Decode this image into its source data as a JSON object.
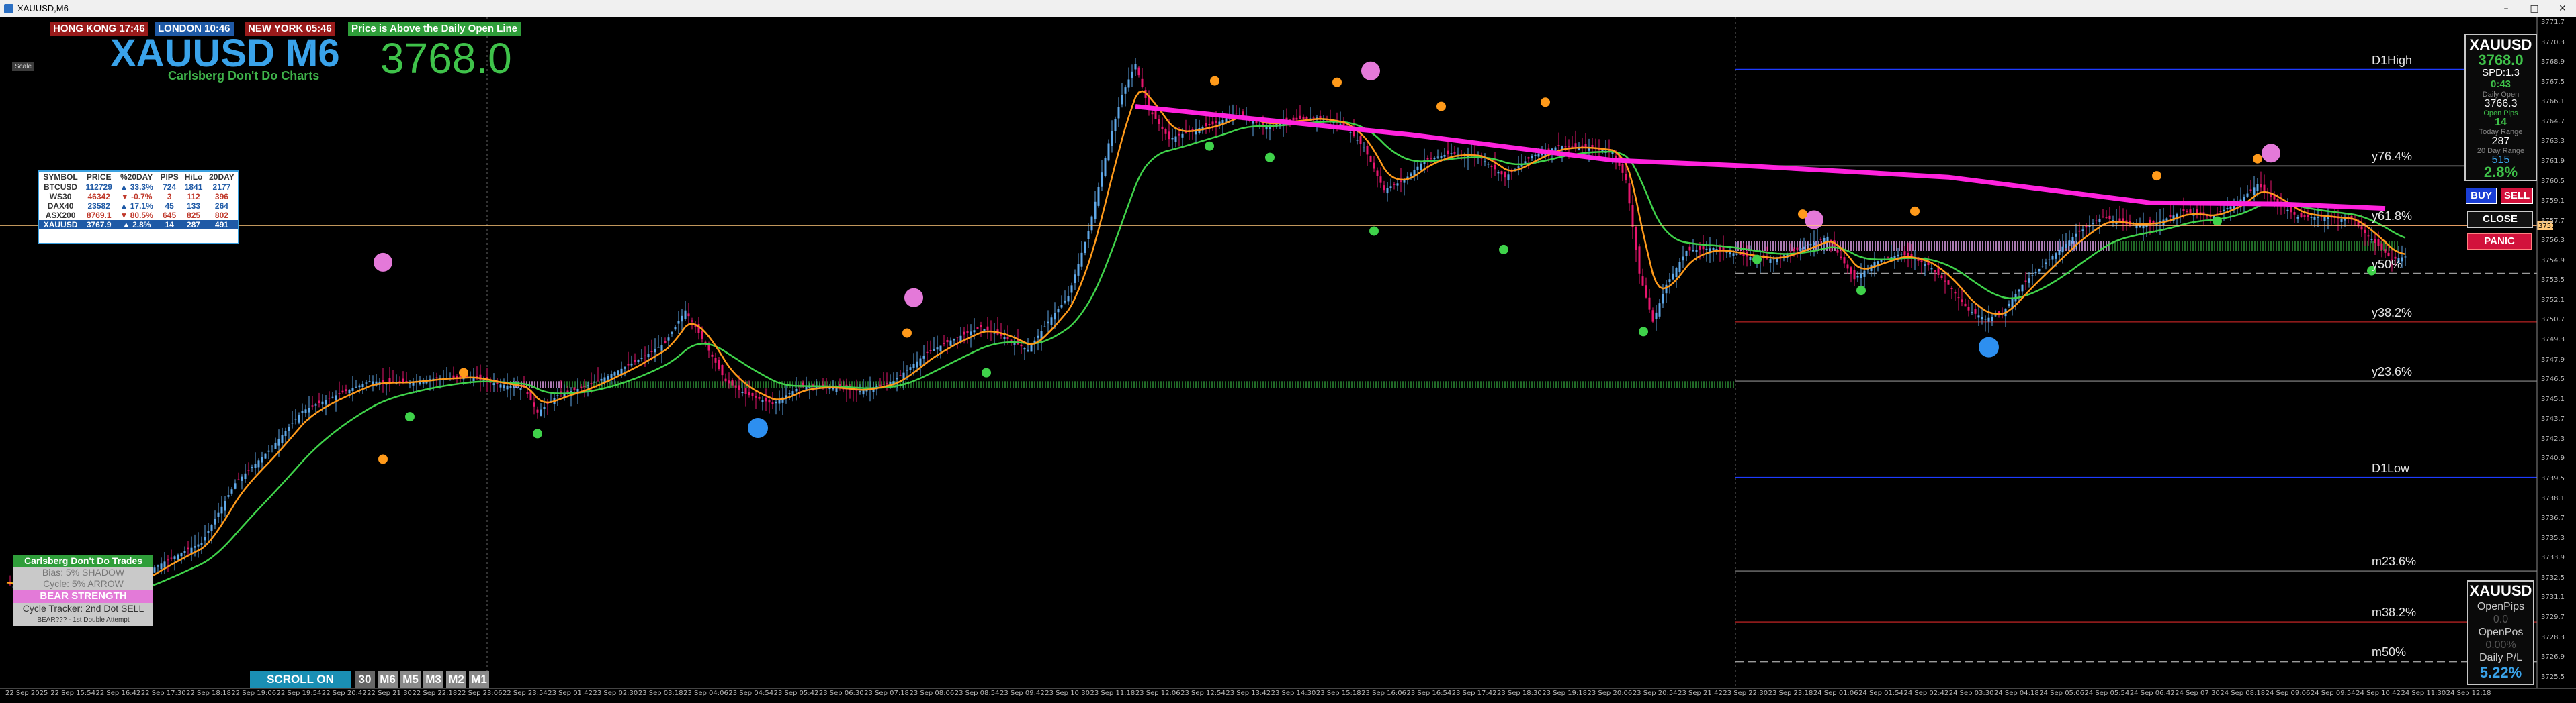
{
  "window": {
    "title": "XAUUSD,M6"
  },
  "sessions": [
    {
      "label": "HONG KONG 17:46",
      "bg": "#9a1b1b"
    },
    {
      "label": "LONDON 10:46",
      "bg": "#1f5aa6"
    },
    {
      "label": "NEW YORK 05:46",
      "bg": "#9a1b1b"
    }
  ],
  "open_status": "Price is Above the Daily Open Line",
  "scale_label": "Scale",
  "symbol_header": {
    "title": "XAUUSD M6",
    "subtitle": "Carlsberg Don't Do Charts",
    "price": "3768.0"
  },
  "watchlist": {
    "columns": [
      "SYMBOL",
      "PRICE",
      "%20DAY",
      "PIPS",
      "HiLo",
      "20DAY"
    ],
    "rows": [
      {
        "symbol": "BTCUSD",
        "price": "112729",
        "pct": "▲ 33.3%",
        "pips": "724",
        "hilo": "1841",
        "day20": "2177",
        "color": "#1f5aa6"
      },
      {
        "symbol": "WS30",
        "price": "46342",
        "pct": "▼ -0.7%",
        "pips": "3",
        "hilo": "112",
        "day20": "396",
        "color": "#c0392b"
      },
      {
        "symbol": "DAX40",
        "price": "23582",
        "pct": "▲ 17.1%",
        "pips": "45",
        "hilo": "133",
        "day20": "264",
        "color": "#1f5aa6"
      },
      {
        "symbol": "ASX200",
        "price": "8769.1",
        "pct": "▼ 80.5%",
        "pips": "645",
        "hilo": "825",
        "day20": "802",
        "color": "#c0392b"
      },
      {
        "symbol": "XAUUSD",
        "price": "3767.9",
        "pct": "▲ 2.8%",
        "pips": "14",
        "hilo": "287",
        "day20": "491",
        "color": "#1f5aa6"
      }
    ]
  },
  "levels": [
    {
      "label": "D1High",
      "price": 3768.4,
      "color": "#1e3cff"
    },
    {
      "label": "y76.4%",
      "price": 3761.6,
      "color": "#5a5a5a"
    },
    {
      "label": "y61.8%",
      "price": 3757.4,
      "color": "#8b1a1a"
    },
    {
      "label": "y50%",
      "price": 3754.0,
      "color": "#9a9a9a"
    },
    {
      "label": "y38.2%",
      "price": 3750.6,
      "color": "#8b1a1a"
    },
    {
      "label": "y23.6%",
      "price": 3746.4,
      "color": "#5a5a5a"
    },
    {
      "label": "D1Low",
      "price": 3739.6,
      "color": "#1e3cff"
    },
    {
      "label": "m23.6%",
      "price": 3733.0,
      "color": "#5a5a5a"
    },
    {
      "label": "m38.2%",
      "price": 3729.4,
      "color": "#8b1a1a"
    },
    {
      "label": "m50%",
      "price": 3726.6,
      "color": "#9a9a9a"
    }
  ],
  "info_panel": {
    "symbol": "XAUUSD",
    "price": "3768.0",
    "spread": "SPD:1.3",
    "timer": "0:43",
    "daily_open_label": "Daily Open",
    "daily_open": "3766.3",
    "open_pips_label": "Open Pips",
    "open_pips": "14",
    "today_range_label": "Today Range",
    "today_range": "287",
    "day20_range_label": "20 Day Range",
    "day20_range": "515",
    "day20_pct": "2.8%"
  },
  "trade_buttons": {
    "buy": "BUY",
    "sell": "SELL",
    "close": "CLOSE",
    "panic": "PANIC"
  },
  "position_panel": {
    "symbol": "XAUUSD",
    "open_pips_label": "OpenPips",
    "open_pips": "0.0",
    "open_pos_label": "OpenPos",
    "open_pos": "0.00%",
    "daily_pl_label": "Daily P/L",
    "daily_pl": "5.22%"
  },
  "cycle_panel": {
    "title": "Carlsberg Don't Do Trades",
    "bias": "Bias: 5% SHADOW",
    "cycle": "Cycle: 5% ARROW",
    "strength": "BEAR STRENGTH",
    "tracker": "Cycle Tracker: 2nd Dot SELL",
    "note": "BEAR??? - 1st Double Attempt"
  },
  "scroll_bar": {
    "label": "SCROLL ON",
    "timeframes": [
      "30",
      "M6",
      "M5",
      "M3",
      "M2",
      "M1"
    ]
  },
  "price_line": {
    "price": 3757.4,
    "label": "3757.4"
  },
  "y_axis": {
    "min": 3725.2,
    "max": 3771.7,
    "step": 1.4
  },
  "x_axis": {
    "ticks": [
      "22 Sep 2025",
      "22 Sep 15:54",
      "22 Sep 16:42",
      "22 Sep 17:30",
      "22 Sep 18:18",
      "22 Sep 19:06",
      "22 Sep 19:54",
      "22 Sep 20:42",
      "22 Sep 21:30",
      "22 Sep 22:18",
      "22 Sep 23:06",
      "22 Sep 23:54",
      "23 Sep 01:42",
      "23 Sep 02:30",
      "23 Sep 03:18",
      "23 Sep 04:06",
      "23 Sep 04:54",
      "23 Sep 05:42",
      "23 Sep 06:30",
      "23 Sep 07:18",
      "23 Sep 08:06",
      "23 Sep 08:54",
      "23 Sep 09:42",
      "23 Sep 10:30",
      "23 Sep 11:18",
      "23 Sep 12:06",
      "23 Sep 12:54",
      "23 Sep 13:42",
      "23 Sep 14:30",
      "23 Sep 15:18",
      "23 Sep 16:06",
      "23 Sep 16:54",
      "23 Sep 17:42",
      "23 Sep 18:30",
      "23 Sep 19:18",
      "23 Sep 20:06",
      "23 Sep 20:54",
      "23 Sep 21:42",
      "23 Sep 22:30",
      "23 Sep 23:18",
      "24 Sep 01:06",
      "24 Sep 01:54",
      "24 Sep 02:42",
      "24 Sep 03:30",
      "24 Sep 04:18",
      "24 Sep 05:06",
      "24 Sep 05:54",
      "24 Sep 06:42",
      "24 Sep 07:30",
      "24 Sep 08:18",
      "24 Sep 09:06",
      "24 Sep 09:54",
      "24 Sep 10:42",
      "24 Sep 11:30",
      "24 Sep 12:18"
    ]
  },
  "colors": {
    "bull": "#5fa8e8",
    "bear": "#e8166e",
    "slow_ma": "#3fd24a",
    "fast_ma": "#ff9a1a",
    "daily_open": "#ff22dd",
    "price_line": "#ffc87a"
  },
  "icon_names": [
    "scale-icon",
    "signal-circle-icon"
  ]
}
